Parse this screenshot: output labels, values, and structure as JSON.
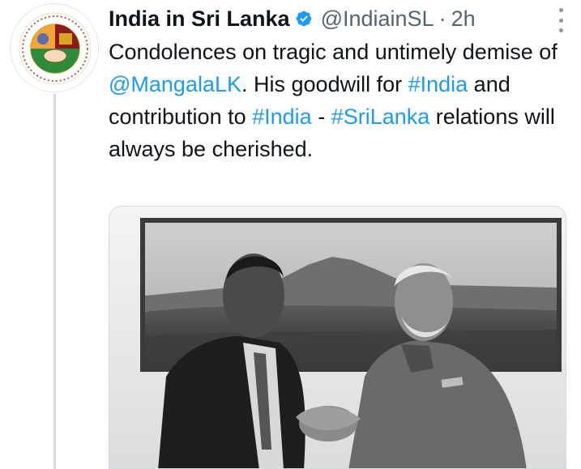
{
  "tweet": {
    "author_name": "India in Sri Lanka",
    "handle": "@IndiainSL",
    "separator": "·",
    "time": "2h",
    "text": {
      "p1": "Condolences on tragic and untimely demise of ",
      "mention": "@MangalaLK",
      "p2": ". His goodwill for ",
      "hashtag1": "#India",
      "p3": " and contribution to ",
      "hashtag2": "#India",
      "p4": " - ",
      "hashtag3": "#SriLanka",
      "p5": " relations will always be cherished."
    }
  },
  "avatar": {
    "logo_alt": "India–Sri Lanka Friendship logo",
    "colors": {
      "saffron": "#f2a33a",
      "green": "#2e8b3a",
      "maroon": "#8b1a1a",
      "gold": "#d9a520"
    }
  },
  "icons": {
    "verified": "verified-badge-icon",
    "more": "more-options-icon"
  },
  "colors": {
    "link": "#1d9bf0",
    "secondary_text": "#536471",
    "verified": "#1d9bf0"
  },
  "media": {
    "alt": "Black and white photo of two men shaking hands in front of a mountain landscape painting"
  }
}
